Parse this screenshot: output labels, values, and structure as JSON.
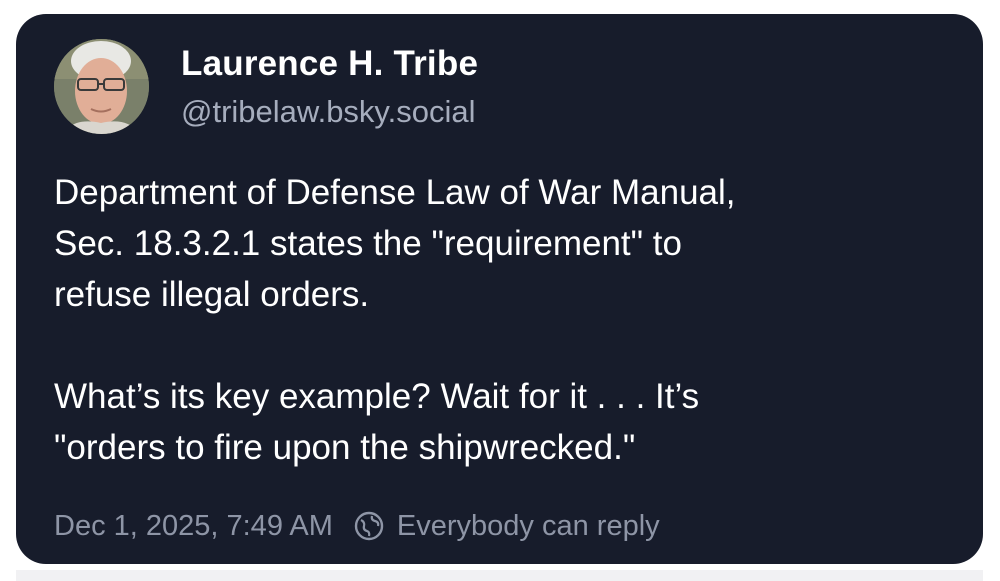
{
  "author": {
    "display_name": "Laurence H. Tribe",
    "handle": "@tribelaw.bsky.social",
    "avatar_icon": "person-photo"
  },
  "post": {
    "paragraph1_lines": [
      "Department of Defense Law of War Manual,",
      "Sec. 18.3.2.1 states the \"requirement\" to",
      "refuse illegal orders."
    ],
    "paragraph2_lines": [
      "What’s its key example? Wait for it . . . It’s",
      "\"orders to fire upon the shipwrecked.\""
    ]
  },
  "footer": {
    "timestamp": "Dec 1, 2025, 7:49 AM",
    "reply_setting_icon": "globe-icon",
    "reply_setting": "Everybody can reply"
  },
  "colors": {
    "card_background": "#171c2b",
    "primary_text": "#ffffff",
    "secondary_text": "#a6adbd"
  }
}
